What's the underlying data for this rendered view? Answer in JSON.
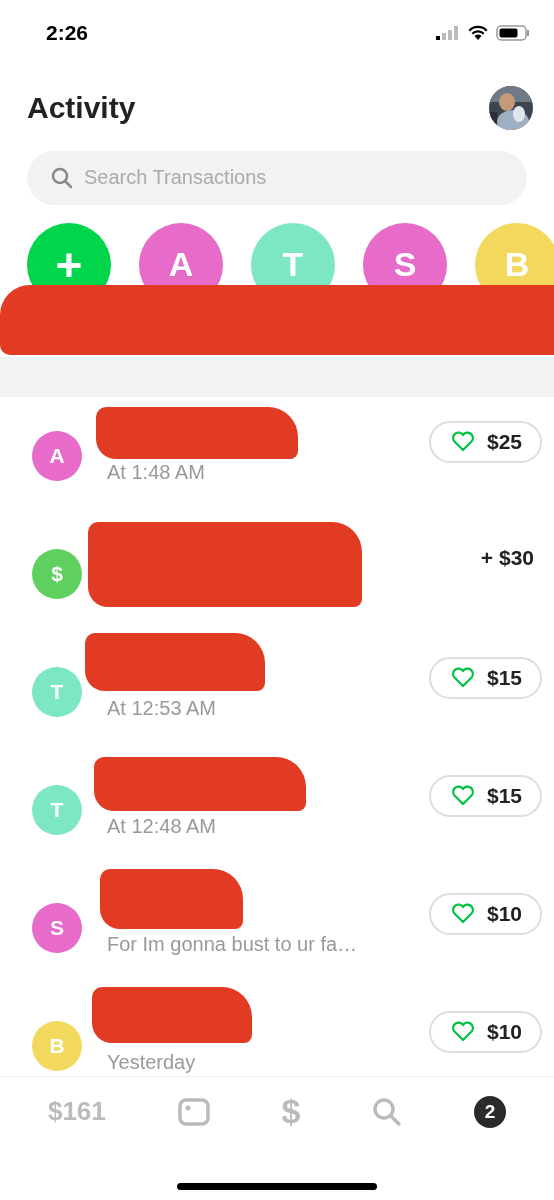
{
  "status_bar": {
    "time": "2:26"
  },
  "header": {
    "title": "Activity"
  },
  "search": {
    "placeholder": "Search Transactions"
  },
  "contacts": [
    {
      "kind": "add",
      "label": "+",
      "color": "#00d54b"
    },
    {
      "kind": "letter",
      "label": "A",
      "color": "#e76bc8"
    },
    {
      "kind": "letter",
      "label": "T",
      "color": "#7de6c5"
    },
    {
      "kind": "letter",
      "label": "S",
      "color": "#e76bc8"
    },
    {
      "kind": "letter",
      "label": "B",
      "color": "#f2d95e"
    }
  ],
  "transactions": [
    {
      "avatar": "A",
      "color": "#e76bc8",
      "subtitle": "At 1:48 AM",
      "kind": "pill",
      "amount": "$25"
    },
    {
      "avatar": "$",
      "color": "#5fcf5f",
      "kind": "plain",
      "amount": "+ $30"
    },
    {
      "avatar": "T",
      "color": "#7de6c5",
      "subtitle": "At 12:53 AM",
      "kind": "pill",
      "amount": "$15"
    },
    {
      "avatar": "T",
      "color": "#7de6c5",
      "subtitle": "At 12:48 AM",
      "kind": "pill",
      "amount": "$15"
    },
    {
      "avatar": "S",
      "color": "#e76bc8",
      "subtitle": "For Im gonna bust to ur fa…",
      "kind": "pill",
      "amount": "$10"
    },
    {
      "avatar": "B",
      "color": "#f2d95e",
      "subtitle": "Yesterday",
      "kind": "pill",
      "amount": "$10"
    }
  ],
  "tab_bar": {
    "balance": "$161",
    "cash": "$",
    "badge": "2"
  }
}
